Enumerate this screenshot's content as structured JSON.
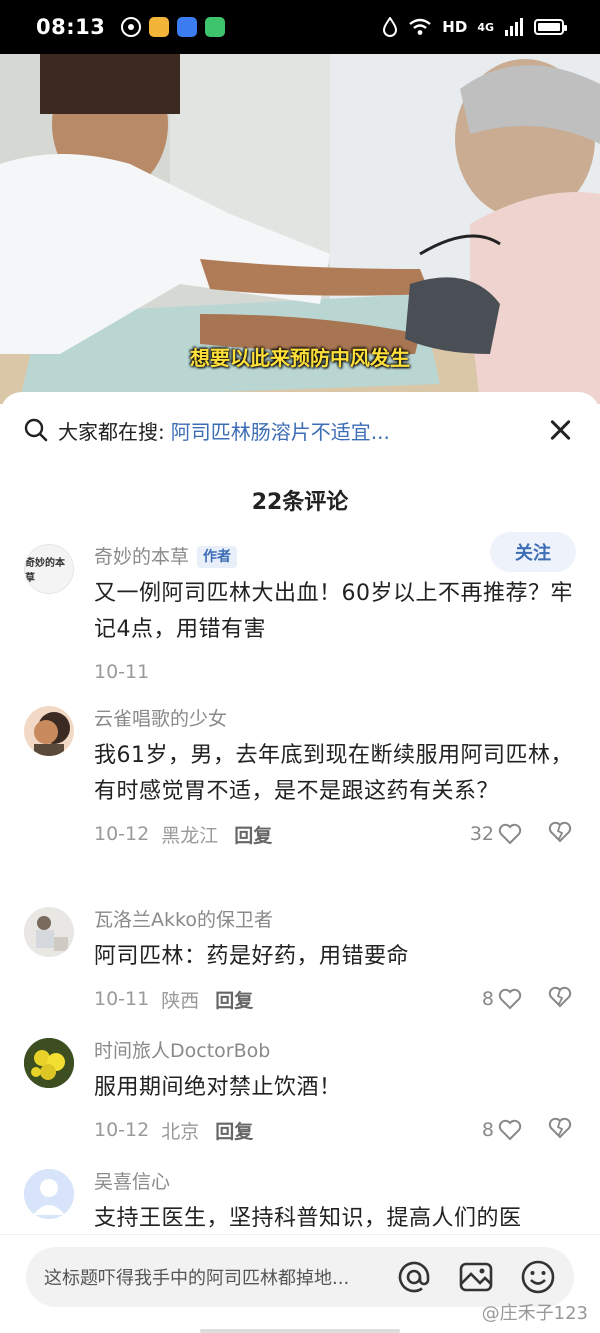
{
  "status_bar": {
    "time": "08:13",
    "network": "HD",
    "signal": "4G"
  },
  "video": {
    "subtitle": "想要以此来预防中风发生"
  },
  "search": {
    "prefix": "大家都在搜:",
    "query": "阿司匹林肠溶片不适宜..."
  },
  "comment_count": "22条评论",
  "comments": [
    {
      "name": "奇妙的本草",
      "tag": "作者",
      "follow": "关注",
      "avatar_text": "奇妙的本草",
      "text": "又一例阿司匹林大出血！60岁以上不再推荐？牢记4点，用错有害",
      "date": "10-11"
    },
    {
      "name": "云雀唱歌的少女",
      "text": "我61岁，男，去年底到现在断续服用阿司匹林，有时感觉胃不适，是不是跟这药有关系？",
      "date": "10-12",
      "location": "黑龙江",
      "reply": "回复",
      "likes": "32"
    },
    {
      "name": "瓦洛兰Akko的保卫者",
      "text": "阿司匹林：药是好药，用错要命",
      "date": "10-11",
      "location": "陕西",
      "reply": "回复",
      "likes": "8"
    },
    {
      "name": "时间旅人DoctorBob",
      "text": "服用期间绝对禁止饮酒！",
      "date": "10-12",
      "location": "北京",
      "reply": "回复",
      "likes": "8"
    },
    {
      "name": "吴喜信心",
      "text": "支持王医生，坚持科普知识，提高人们的医"
    }
  ],
  "input": {
    "placeholder": "这标题吓得我手中的阿司匹林都掉地...",
    "watermark": "@庄禾子123"
  },
  "icons": [
    "search-icon",
    "close-icon",
    "heart-icon",
    "dislike-icon",
    "at-icon",
    "image-icon",
    "emoji-icon"
  ],
  "colors": {
    "accent": "#3d6db5",
    "subtitle": "#ffe03a",
    "meta": "#9a9a9a"
  }
}
